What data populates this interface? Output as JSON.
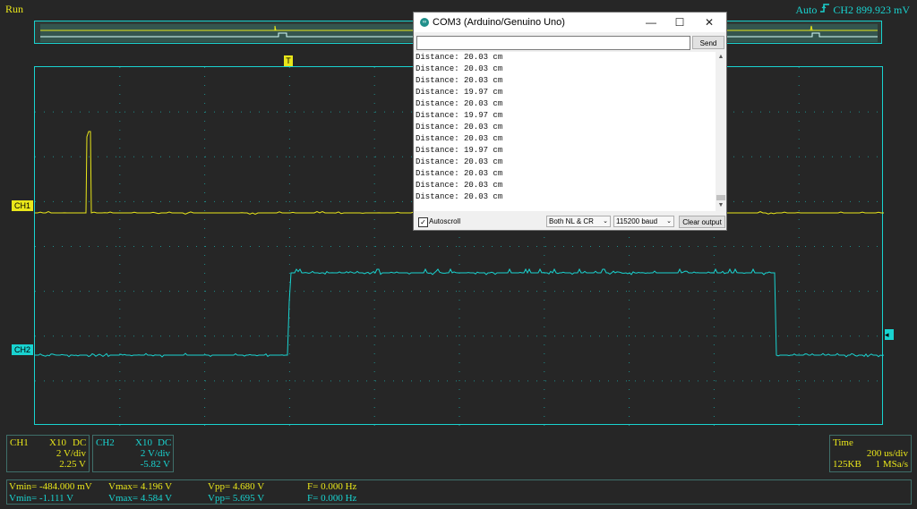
{
  "scope": {
    "status": "Run",
    "trigger": {
      "mode": "Auto",
      "channel_level": "CH2 899.923 mV",
      "marker_label": "T",
      "icon": "rising-edge-icon"
    },
    "markers": {
      "ch1": "CH1",
      "ch2": "CH2"
    },
    "colors": {
      "ch1": "#e9e61a",
      "ch2": "#19d3d0",
      "grid": "#19d3d0",
      "background": "#262626"
    }
  },
  "channels": {
    "ch1": {
      "name": "CH1",
      "probe": "X10",
      "coupling": "DC",
      "scale": "2 V/div",
      "offset": "2.25 V"
    },
    "ch2": {
      "name": "CH2",
      "probe": "X10",
      "coupling": "DC",
      "scale": "2 V/div",
      "offset": "-5.82 V"
    }
  },
  "timebase": {
    "label": "Time",
    "scale": "200 us/div",
    "memory": "125KB",
    "sample_rate": "1 MSa/s"
  },
  "measurements": {
    "ch1": {
      "vmin": "Vmin= -484.000 mV",
      "vmax": "Vmax= 4.196 V",
      "vpp": "Vpp= 4.680 V",
      "freq": "F= 0.000 Hz"
    },
    "ch2": {
      "vmin": "Vmin= -1.111 V",
      "vmax": "Vmax= 4.584 V",
      "vpp": "Vpp= 5.695 V",
      "freq": "F= 0.000 Hz"
    }
  },
  "serial_monitor": {
    "title": "COM3 (Arduino/Genuino Uno)",
    "window_controls": {
      "minimize": "—",
      "maximize": "☐",
      "close": "✕"
    },
    "input_value": "",
    "send_label": "Send",
    "lines": [
      "Distance: 20.03 cm",
      "Distance: 20.03 cm",
      "Distance: 20.03 cm",
      "Distance: 19.97 cm",
      "Distance: 20.03 cm",
      "Distance: 19.97 cm",
      "Distance: 20.03 cm",
      "Distance: 20.03 cm",
      "Distance: 19.97 cm",
      "Distance: 20.03 cm",
      "Distance: 20.03 cm",
      "Distance: 20.03 cm",
      "Distance: 20.03 cm"
    ],
    "autoscroll_label": "Autoscroll",
    "autoscroll_checked": true,
    "line_ending": "Both NL & CR",
    "baud": "115200 baud",
    "clear_label": "Clear output"
  }
}
